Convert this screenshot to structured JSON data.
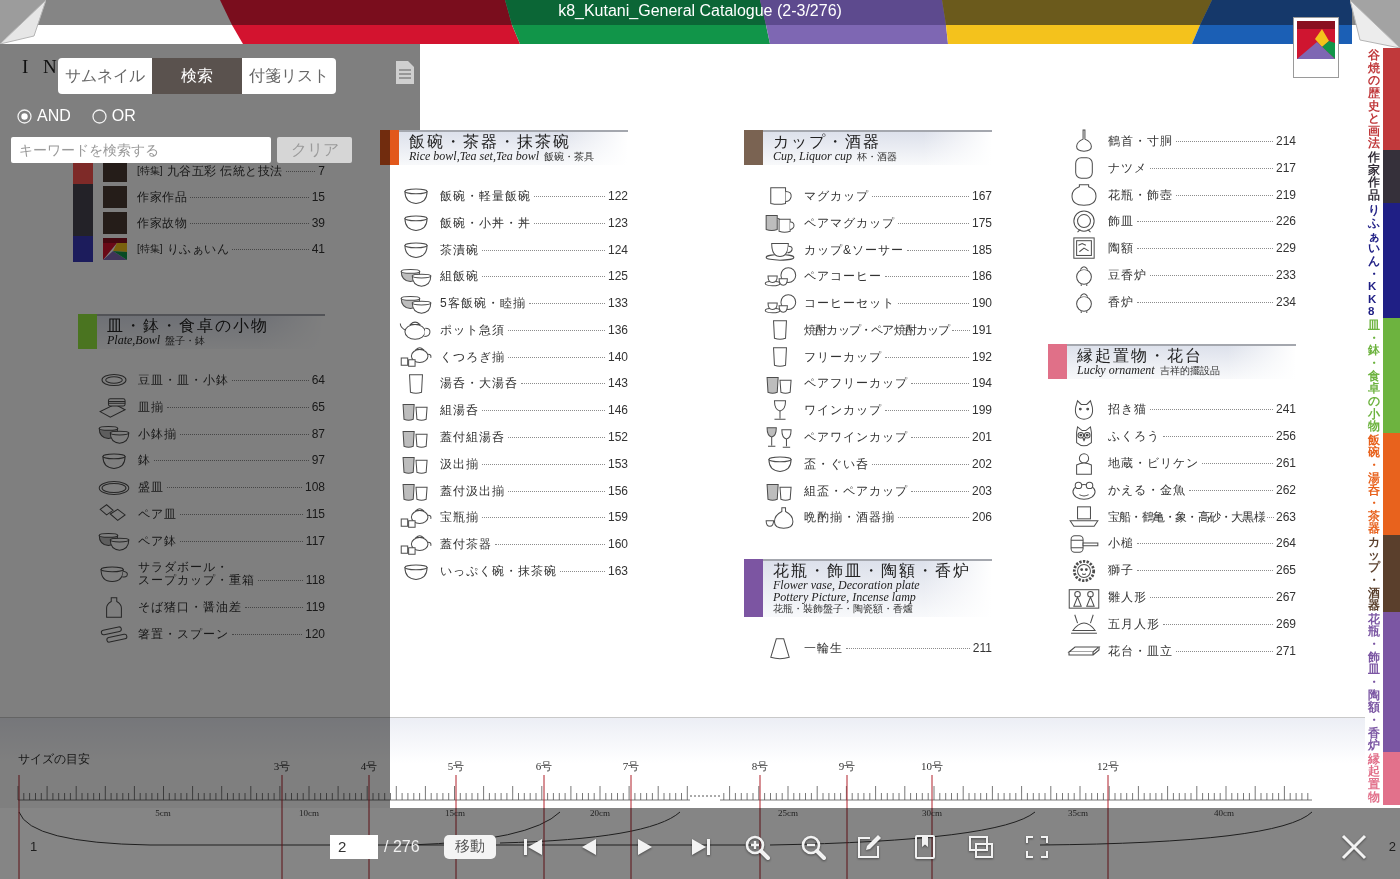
{
  "header": {
    "title": "k8_Kutani_General Catalogue (2-3/276)"
  },
  "search_panel": {
    "tabs": [
      {
        "label": "サムネイル",
        "selected": false
      },
      {
        "label": "検索",
        "selected": true
      },
      {
        "label": "付箋リスト",
        "selected": false
      }
    ],
    "match_modes": [
      {
        "label": "AND",
        "selected": true
      },
      {
        "label": "OR",
        "selected": false
      }
    ],
    "search": {
      "placeholder": "キーワードを検索する"
    },
    "clear_button": "クリア"
  },
  "pages": [
    {
      "index_title": "I N",
      "columns": [
        {
          "chapters": [
            {
              "color": "#7e2a28",
              "rows": [
                {
                  "kind": "photo",
                  "tag": "[特集]",
                  "title": "九谷五彩 伝統と技法",
                  "page": "7"
                }
              ]
            },
            {
              "color": "#232228",
              "rows": [
                {
                  "kind": "photo",
                  "title": "作家作品",
                  "page": "15"
                },
                {
                  "kind": "photo",
                  "title": "作家故物",
                  "page": "39"
                }
              ]
            },
            {
              "color": "#1c1c5c",
              "rows": [
                {
                  "kind": "logo",
                  "tag": "[特集]",
                  "title": "りふぁいん",
                  "page": "41"
                }
              ]
            }
          ],
          "blocks": [
            {
              "section": {
                "title": "皿・鉢・食卓の小物",
                "subtitle": [
                  "Plate,Bowl"
                ],
                "note": "盤子・鉢",
                "color": "#4a7420"
              },
              "items": [
                {
                  "name": "豆皿・皿・小鉢",
                  "page": "64"
                },
                {
                  "name": "皿揃",
                  "page": "65"
                },
                {
                  "name": "小鉢揃",
                  "page": "87"
                },
                {
                  "name": "鉢",
                  "page": "97"
                },
                {
                  "name": "盛皿",
                  "page": "108"
                },
                {
                  "name": "ペア皿",
                  "page": "115"
                },
                {
                  "name": "ペア鉢",
                  "page": "117"
                },
                {
                  "lines": [
                    "サラダボール・",
                    "スープカップ・重箱"
                  ],
                  "page": "118"
                },
                {
                  "name": "そば猪口・醤油差",
                  "page": "119"
                },
                {
                  "name": "箸置・スプーン",
                  "page": "120"
                }
              ]
            }
          ]
        },
        {
          "blocks": [
            {
              "section": {
                "title": "飯碗・茶器・抹茶碗",
                "subtitle": [
                  "Rice bowl,Tea set,Tea bowl"
                ],
                "note": "飯碗・茶具",
                "color": "#e2581c"
              },
              "items": [
                {
                  "name": "飯碗・軽量飯碗",
                  "page": "122"
                },
                {
                  "name": "飯碗・小丼・丼",
                  "page": "123"
                },
                {
                  "name": "茶漬碗",
                  "page": "124"
                },
                {
                  "name": "組飯碗",
                  "page": "125"
                },
                {
                  "name": "5客飯碗・睦揃",
                  "page": "133"
                },
                {
                  "name": "ポット急須",
                  "page": "136"
                },
                {
                  "name": "くつろぎ揃",
                  "page": "140"
                },
                {
                  "name": "湯呑・大湯呑",
                  "page": "143"
                },
                {
                  "name": "組湯呑",
                  "page": "146"
                },
                {
                  "name": "蓋付組湯呑",
                  "page": "152"
                },
                {
                  "name": "汲出揃",
                  "page": "153"
                },
                {
                  "name": "蓋付汲出揃",
                  "page": "156"
                },
                {
                  "name": "宝瓶揃",
                  "page": "159"
                },
                {
                  "name": "蓋付茶器",
                  "page": "160"
                },
                {
                  "name": "いっぷく碗・抹茶碗",
                  "page": "163"
                }
              ]
            }
          ]
        }
      ]
    },
    {
      "columns": [
        {
          "blocks": [
            {
              "section": {
                "title": "カップ・酒器",
                "subtitle": [
                  "Cup, Liquor cup"
                ],
                "note": "杯・酒器",
                "color": "#7a6352"
              },
              "items": [
                {
                  "name": "マグカップ",
                  "page": "167"
                },
                {
                  "name": "ペアマグカップ",
                  "page": "175"
                },
                {
                  "name": "カップ&ソーサー",
                  "page": "185"
                },
                {
                  "name": "ペアコーヒー",
                  "page": "186"
                },
                {
                  "name": "コーヒーセット",
                  "page": "190"
                },
                {
                  "name": "焼酎カップ・ペア焼酎カップ",
                  "page": "191"
                },
                {
                  "name": "フリーカップ",
                  "page": "192"
                },
                {
                  "name": "ペアフリーカップ",
                  "page": "194"
                },
                {
                  "name": "ワインカップ",
                  "page": "199"
                },
                {
                  "name": "ペアワインカップ",
                  "page": "201"
                },
                {
                  "name": "盃・ぐい呑",
                  "page": "202"
                },
                {
                  "name": "組盃・ペアカップ",
                  "page": "203"
                },
                {
                  "name": "晩酌揃・酒器揃",
                  "page": "206"
                }
              ]
            },
            {
              "section": {
                "title": "花瓶・飾皿・陶額・香炉",
                "subtitle": [
                  "Flower vase, Decoration plate",
                  "Pottery Picture, Incense lamp"
                ],
                "note": "花瓶・裝飾盤子・陶瓷額・香爐",
                "color": "#7c55a2"
              },
              "items": [
                {
                  "name": "一輪生",
                  "page": "211"
                }
              ]
            }
          ]
        },
        {
          "blocks": [
            {
              "items": [
                {
                  "name": "鶴首・寸胴",
                  "page": "214"
                },
                {
                  "name": "ナツメ",
                  "page": "217"
                },
                {
                  "name": "花瓶・飾壺",
                  "page": "219"
                },
                {
                  "name": "飾皿",
                  "page": "226"
                },
                {
                  "name": "陶額",
                  "page": "229"
                },
                {
                  "name": "豆香炉",
                  "page": "233"
                },
                {
                  "name": "香炉",
                  "page": "234"
                }
              ]
            },
            {
              "section": {
                "title": "縁起置物・花台",
                "subtitle": [
                  "Lucky ornament"
                ],
                "note": "吉祥的擺設品",
                "color": "#e07088"
              },
              "items": [
                {
                  "name": "招き猫",
                  "page": "241"
                },
                {
                  "name": "ふくろう",
                  "page": "256"
                },
                {
                  "name": "地蔵・ビリケン",
                  "page": "261"
                },
                {
                  "name": "かえる・金魚",
                  "page": "262"
                },
                {
                  "name": "宝船・鶴亀・象・高砂・大黒様",
                  "page": "263"
                },
                {
                  "name": "小槌",
                  "page": "264"
                },
                {
                  "name": "獅子",
                  "page": "265"
                },
                {
                  "name": "雛人形",
                  "page": "267"
                },
                {
                  "name": "五月人形",
                  "page": "269"
                },
                {
                  "name": "花台・皿立",
                  "page": "271"
                }
              ]
            }
          ]
        }
      ]
    }
  ],
  "chapter_tabs": [
    {
      "label": "谷焼の歴史と画法",
      "color": "#c0393b"
    },
    {
      "label": "作家作品",
      "color": "#35303a"
    },
    {
      "label": "りふぁいん・KK8",
      "color": "#1f1f85"
    },
    {
      "label": "皿・鉢・食卓の小物",
      "color": "#6db33f"
    },
    {
      "label": "飯碗・湯呑・茶器",
      "color": "#e8621d"
    },
    {
      "label": "カップ・酒器",
      "color": "#5a3f2c"
    },
    {
      "label": "花瓶・飾皿・陶額・香炉",
      "color": "#7b56a3"
    },
    {
      "label": "縁起置物",
      "color": "#e2718b"
    }
  ],
  "size_guide": {
    "label": "サイズの目安",
    "sizes": [
      "3号",
      "4号",
      "5号",
      "6号",
      "7号",
      "8号",
      "9号",
      "10号",
      "12号"
    ],
    "cm_marks": [
      "5cm",
      "10cm",
      "15cm",
      "20cm",
      "25cm",
      "30cm",
      "35cm",
      "40cm"
    ]
  },
  "toolbar": {
    "left_page": "1",
    "page_input": "2",
    "total": "/ 276",
    "go_button": "移動",
    "right_page": "2"
  }
}
